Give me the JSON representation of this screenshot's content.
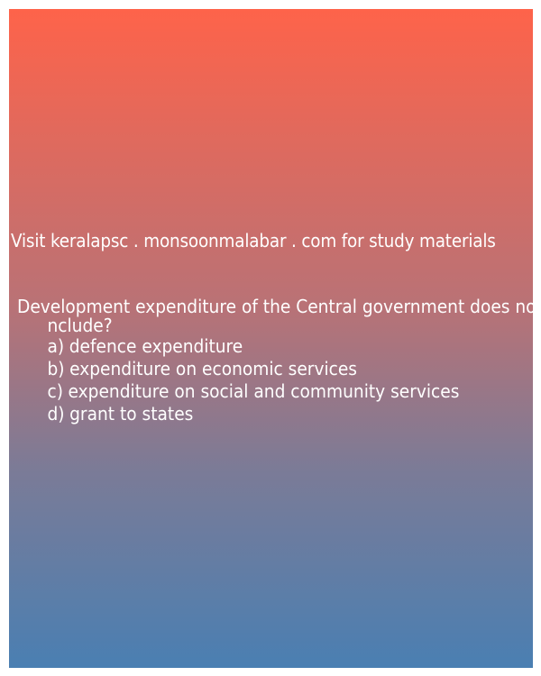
{
  "promo": {
    "text": "Visit keralapsc . monsoonmalabar . com for study materials"
  },
  "question": {
    "text": "Development expenditure of the Central government does not include?",
    "options": [
      {
        "label": "a)",
        "text": "defence expenditure"
      },
      {
        "label": "b)",
        "text": "expenditure on economic services"
      },
      {
        "label": "c)",
        "text": "expenditure on social and community services"
      },
      {
        "label": "d)",
        "text": "grant to states"
      }
    ]
  },
  "colors": {
    "gradient_top": "#fe634a",
    "gradient_bottom": "#4a7fb2",
    "text": "#ffffff"
  }
}
